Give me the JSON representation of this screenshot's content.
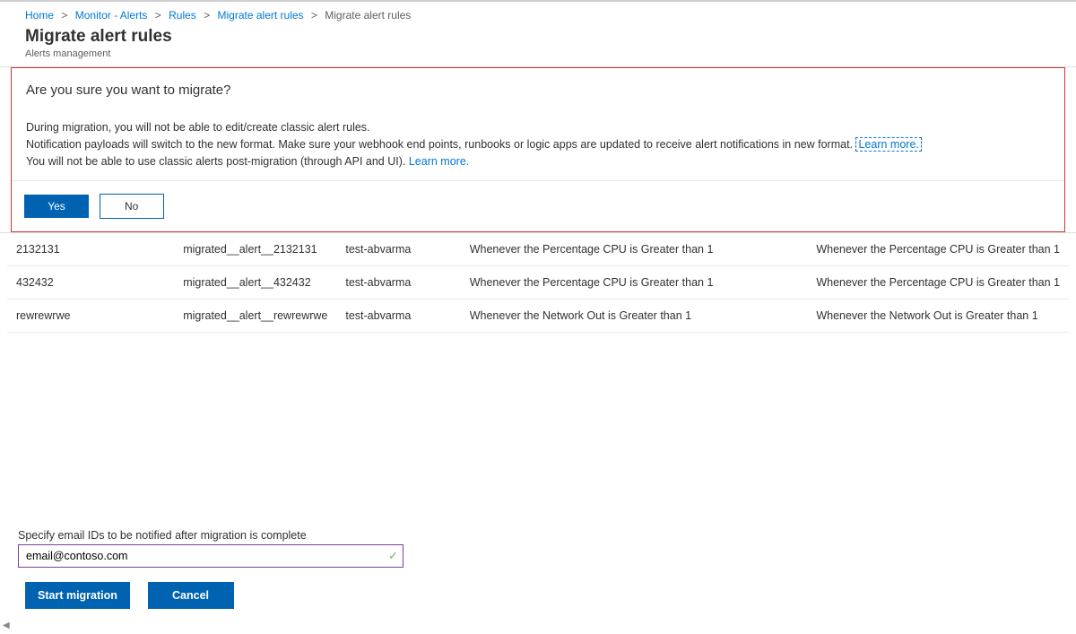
{
  "breadcrumb": {
    "home": "Home",
    "monitor": "Monitor - Alerts",
    "rules": "Rules",
    "migrate1": "Migrate alert rules",
    "current": "Migrate alert rules"
  },
  "header": {
    "title": "Migrate alert rules",
    "subtitle": "Alerts management"
  },
  "dialog": {
    "title": "Are you sure you want to migrate?",
    "line1": "During migration, you will not be able to edit/create classic alert rules.",
    "line2a": "Notification payloads will switch to the new format. Make sure your webhook end points, runbooks or logic apps are updated to receive alert notifications in new format. ",
    "learn_more1": "Learn more.",
    "line3a": "You will not be able to use classic alerts post-migration (through API and UI). ",
    "learn_more2": "Learn more.",
    "yes": "Yes",
    "no": "No"
  },
  "rows": [
    {
      "c1": "2132131",
      "c2": "migrated__alert__2132131",
      "c3": "test-abvarma",
      "c4": "Whenever the Percentage CPU is Greater than 1",
      "c5": "Whenever the Percentage CPU is Greater than 1"
    },
    {
      "c1": "432432",
      "c2": "migrated__alert__432432",
      "c3": "test-abvarma",
      "c4": "Whenever the Percentage CPU is Greater than 1",
      "c5": "Whenever the Percentage CPU is Greater than 1"
    },
    {
      "c1": "rewrewrwe",
      "c2": "migrated__alert__rewrewrwe",
      "c3": "test-abvarma",
      "c4": "Whenever the Network Out is Greater than 1",
      "c5": "Whenever the Network Out is Greater than 1"
    }
  ],
  "form": {
    "label": "Specify email IDs to be notified after migration is complete",
    "value": "email@contoso.com"
  },
  "actions": {
    "start": "Start migration",
    "cancel": "Cancel"
  }
}
